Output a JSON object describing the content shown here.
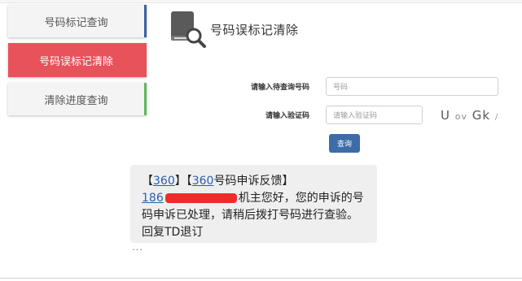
{
  "sidebar": {
    "items": [
      {
        "label": "号码标记查询"
      },
      {
        "label": "号码误标记清除"
      },
      {
        "label": "清除进度查询"
      }
    ]
  },
  "header": {
    "icon": "book-search-icon",
    "title": "号码误标记清除"
  },
  "form": {
    "phone_label": "请输入待查询号码",
    "phone_placeholder": "号码",
    "code_label": "请输入验证码",
    "code_placeholder": "请输入验证码",
    "captcha": {
      "c1": "U",
      "c2": "ov",
      "c3": "Gk",
      "c4": "/"
    },
    "submit_label": "查询"
  },
  "sms": {
    "open1": "【",
    "link1": "360",
    "mid1": "】【",
    "link2": "360",
    "after1": "号码申诉反馈】",
    "number_prefix": "186",
    "body": "机主您好，您的申诉的号码申诉已处理，请稍后拨打号码进行查验。回复TD退订"
  },
  "colors": {
    "active": "#e8525b",
    "accent_blue": "#3d6ca8",
    "accent_green": "#5cb85c",
    "sms_bg": "#efefef"
  }
}
